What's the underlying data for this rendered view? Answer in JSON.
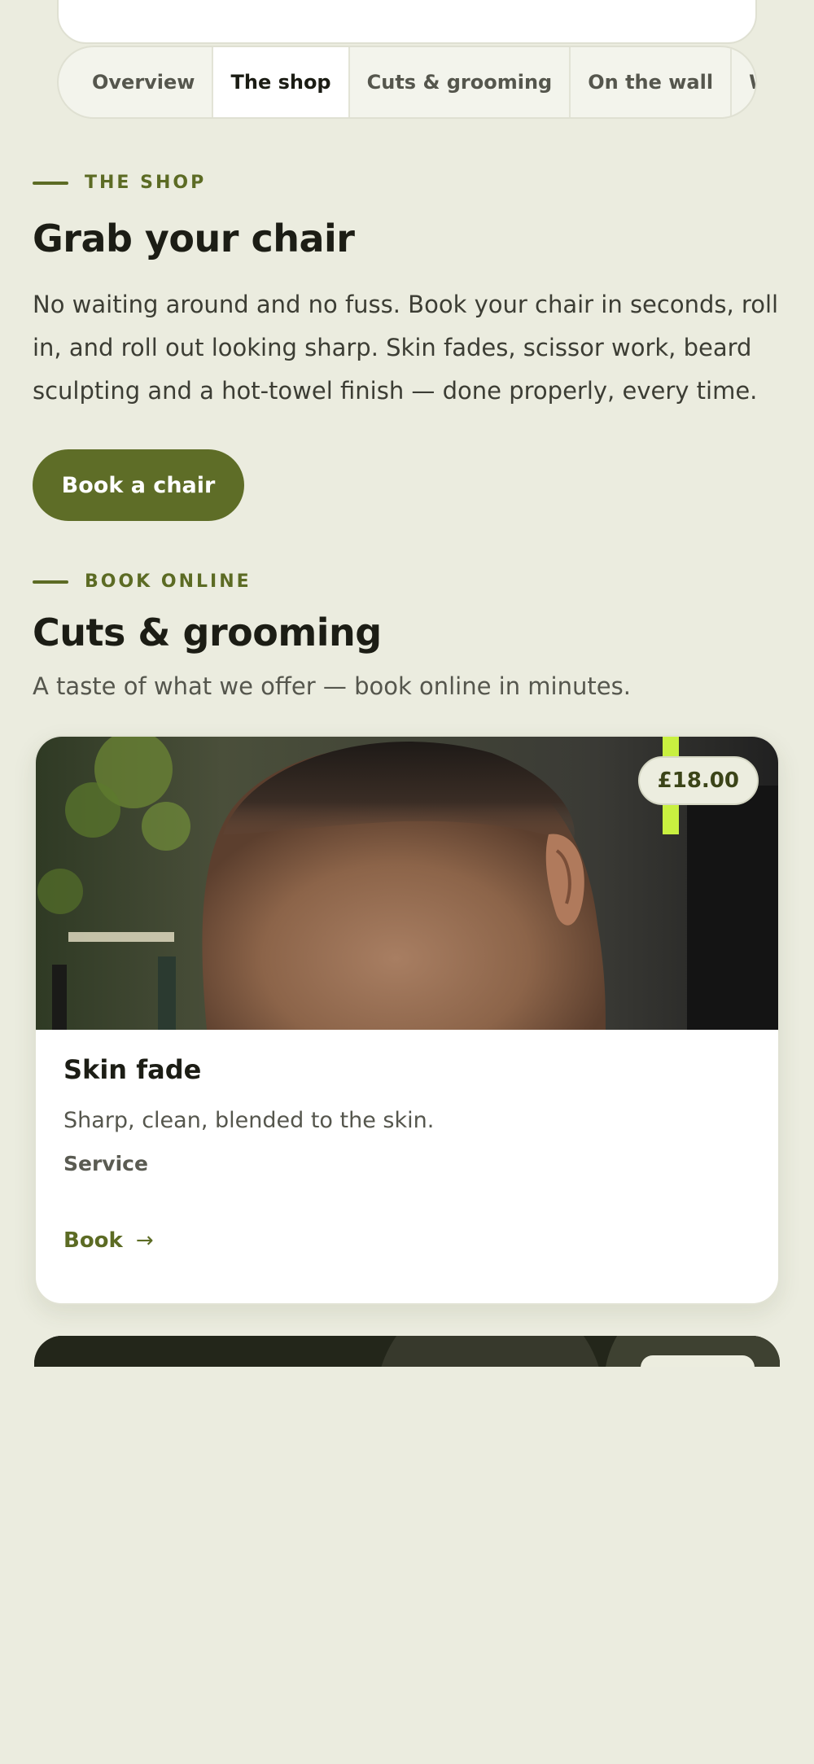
{
  "tabs": [
    {
      "label": "Overview"
    },
    {
      "label": "The shop"
    },
    {
      "label": "Cuts & grooming"
    },
    {
      "label": "On the wall"
    },
    {
      "label": "Why he"
    }
  ],
  "active_tab": "The shop",
  "shop": {
    "eyebrow": "THE SHOP",
    "title": "Grab your chair",
    "intro": "No waiting around and no fuss. Book your chair in seconds, roll in, and roll out looking sharp. Skin fades, scissor work, beard sculpting and a hot-towel finish — done properly, every time.",
    "cta_label": "Book a chair"
  },
  "services": {
    "eyebrow": "BOOK ONLINE",
    "title": "Cuts & grooming",
    "subtitle": "A taste of what we offer — book online in minutes.",
    "items": [
      {
        "name": "Skin fade",
        "description": "Sharp, clean, blended to the skin.",
        "type": "Service",
        "price": "£18.00",
        "book_label": "Book",
        "arrow_icon": "arrow-right-icon"
      }
    ]
  },
  "colors": {
    "background": "#ebecdf",
    "accent": "#5e6d27",
    "text": "#1c1d15"
  }
}
